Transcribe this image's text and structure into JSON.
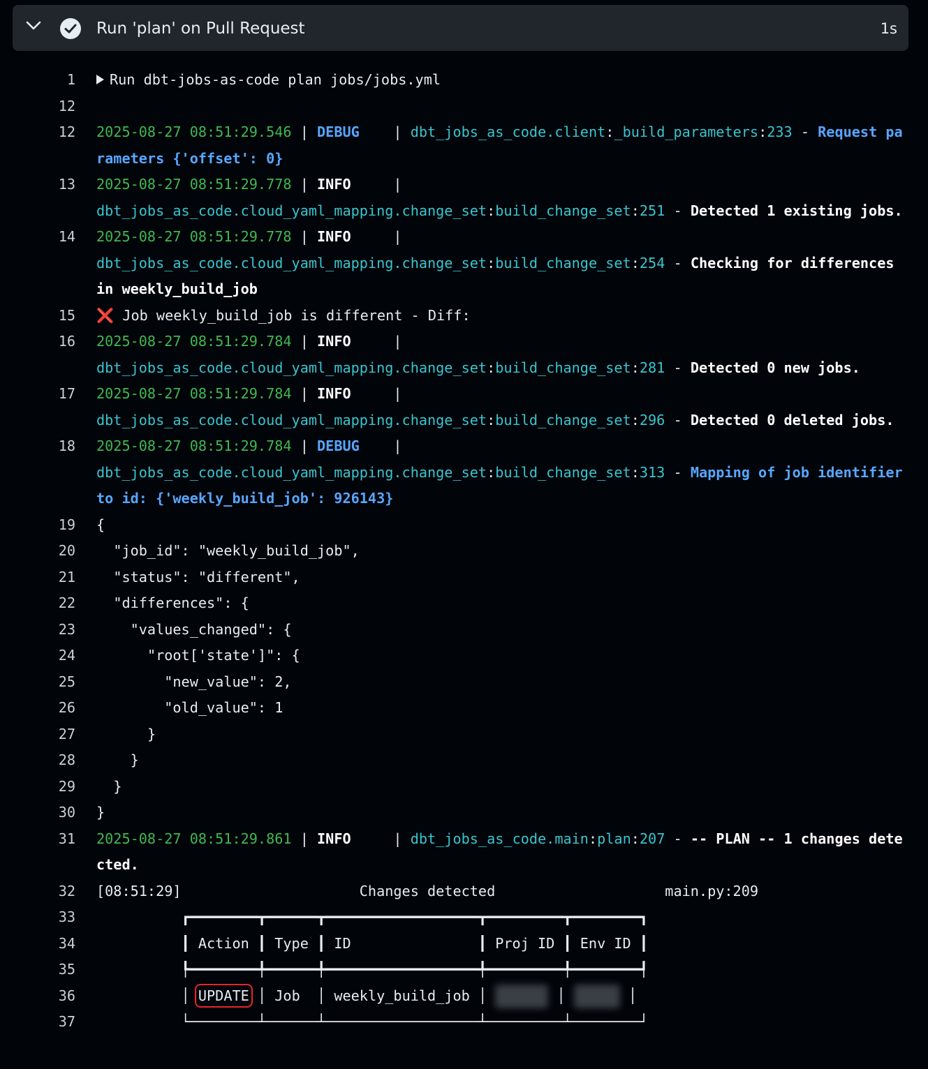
{
  "step": {
    "title": "Run 'plan' on Pull Request",
    "duration": "1s"
  },
  "log": [
    {
      "n": "1",
      "segments": [
        {
          "t": "Run dbt-jobs-as-code plan jobs/jobs.yml",
          "c": "plain"
        }
      ],
      "toggle": true
    },
    {
      "n": "12",
      "segments": []
    },
    {
      "n": "12",
      "segments": [
        {
          "t": "2025-08-27 08:51:29.546",
          "c": "ts"
        },
        {
          "t": " | ",
          "c": "plain"
        },
        {
          "t": "DEBUG",
          "c": "lvl-debug"
        },
        {
          "t": "    | ",
          "c": "plain"
        },
        {
          "t": "dbt_jobs_as_code.client",
          "c": "mod"
        },
        {
          "t": ":",
          "c": "plain"
        },
        {
          "t": "_build_parameters",
          "c": "mod"
        },
        {
          "t": ":",
          "c": "plain"
        },
        {
          "t": "233",
          "c": "mod"
        },
        {
          "t": " - ",
          "c": "plain"
        },
        {
          "t": "Request parameters {'offset': 0}",
          "c": "msg-blue"
        }
      ]
    },
    {
      "n": "13",
      "segments": [
        {
          "t": "2025-08-27 08:51:29.778",
          "c": "ts"
        },
        {
          "t": " | ",
          "c": "plain"
        },
        {
          "t": "INFO",
          "c": "lvl-info"
        },
        {
          "t": "     |\n",
          "c": "plain"
        },
        {
          "t": "dbt_jobs_as_code.cloud_yaml_mapping.change_set",
          "c": "mod"
        },
        {
          "t": ":",
          "c": "plain"
        },
        {
          "t": "build_change_set",
          "c": "mod"
        },
        {
          "t": ":",
          "c": "plain"
        },
        {
          "t": "251",
          "c": "mod"
        },
        {
          "t": " - ",
          "c": "plain"
        },
        {
          "t": "Detected 1 existing jobs.",
          "c": "msg-bold"
        }
      ]
    },
    {
      "n": "14",
      "segments": [
        {
          "t": "2025-08-27 08:51:29.778",
          "c": "ts"
        },
        {
          "t": " | ",
          "c": "plain"
        },
        {
          "t": "INFO",
          "c": "lvl-info"
        },
        {
          "t": "     |\n",
          "c": "plain"
        },
        {
          "t": "dbt_jobs_as_code.cloud_yaml_mapping.change_set",
          "c": "mod"
        },
        {
          "t": ":",
          "c": "plain"
        },
        {
          "t": "build_change_set",
          "c": "mod"
        },
        {
          "t": ":",
          "c": "plain"
        },
        {
          "t": "254",
          "c": "mod"
        },
        {
          "t": " - ",
          "c": "plain"
        },
        {
          "t": "Checking for differences in weekly_build_job",
          "c": "msg-bold"
        }
      ]
    },
    {
      "n": "15",
      "segments": [
        {
          "t": "❌",
          "c": "xmark"
        },
        {
          "t": " Job weekly_build_job is different - Diff:",
          "c": "plain"
        }
      ]
    },
    {
      "n": "16",
      "segments": [
        {
          "t": "2025-08-27 08:51:29.784",
          "c": "ts"
        },
        {
          "t": " | ",
          "c": "plain"
        },
        {
          "t": "INFO",
          "c": "lvl-info"
        },
        {
          "t": "     |\n",
          "c": "plain"
        },
        {
          "t": "dbt_jobs_as_code.cloud_yaml_mapping.change_set",
          "c": "mod"
        },
        {
          "t": ":",
          "c": "plain"
        },
        {
          "t": "build_change_set",
          "c": "mod"
        },
        {
          "t": ":",
          "c": "plain"
        },
        {
          "t": "281",
          "c": "mod"
        },
        {
          "t": " - ",
          "c": "plain"
        },
        {
          "t": "Detected 0 new jobs.",
          "c": "msg-bold"
        }
      ]
    },
    {
      "n": "17",
      "segments": [
        {
          "t": "2025-08-27 08:51:29.784",
          "c": "ts"
        },
        {
          "t": " | ",
          "c": "plain"
        },
        {
          "t": "INFO",
          "c": "lvl-info"
        },
        {
          "t": "     |\n",
          "c": "plain"
        },
        {
          "t": "dbt_jobs_as_code.cloud_yaml_mapping.change_set",
          "c": "mod"
        },
        {
          "t": ":",
          "c": "plain"
        },
        {
          "t": "build_change_set",
          "c": "mod"
        },
        {
          "t": ":",
          "c": "plain"
        },
        {
          "t": "296",
          "c": "mod"
        },
        {
          "t": " - ",
          "c": "plain"
        },
        {
          "t": "Detected 0 deleted jobs.",
          "c": "msg-bold"
        }
      ]
    },
    {
      "n": "18",
      "segments": [
        {
          "t": "2025-08-27 08:51:29.784",
          "c": "ts"
        },
        {
          "t": " | ",
          "c": "plain"
        },
        {
          "t": "DEBUG",
          "c": "lvl-debug"
        },
        {
          "t": "    |\n",
          "c": "plain"
        },
        {
          "t": "dbt_jobs_as_code.cloud_yaml_mapping.change_set",
          "c": "mod"
        },
        {
          "t": ":",
          "c": "plain"
        },
        {
          "t": "build_change_set",
          "c": "mod"
        },
        {
          "t": ":",
          "c": "plain"
        },
        {
          "t": "313",
          "c": "mod"
        },
        {
          "t": " - ",
          "c": "plain"
        },
        {
          "t": "Mapping of job identifier to id: {'weekly_build_job': 926143}",
          "c": "msg-blue"
        }
      ]
    },
    {
      "n": "19",
      "segments": [
        {
          "t": "{",
          "c": "plain"
        }
      ]
    },
    {
      "n": "20",
      "segments": [
        {
          "t": "  \"job_id\": \"weekly_build_job\",",
          "c": "plain"
        }
      ]
    },
    {
      "n": "21",
      "segments": [
        {
          "t": "  \"status\": \"different\",",
          "c": "plain"
        }
      ]
    },
    {
      "n": "22",
      "segments": [
        {
          "t": "  \"differences\": {",
          "c": "plain"
        }
      ]
    },
    {
      "n": "23",
      "segments": [
        {
          "t": "    \"values_changed\": {",
          "c": "plain"
        }
      ]
    },
    {
      "n": "24",
      "segments": [
        {
          "t": "      \"root['state']\": {",
          "c": "plain"
        }
      ]
    },
    {
      "n": "25",
      "segments": [
        {
          "t": "        \"new_value\": 2,",
          "c": "plain"
        }
      ]
    },
    {
      "n": "26",
      "segments": [
        {
          "t": "        \"old_value\": 1",
          "c": "plain"
        }
      ]
    },
    {
      "n": "27",
      "segments": [
        {
          "t": "      }",
          "c": "plain"
        }
      ]
    },
    {
      "n": "28",
      "segments": [
        {
          "t": "    }",
          "c": "plain"
        }
      ]
    },
    {
      "n": "29",
      "segments": [
        {
          "t": "  }",
          "c": "plain"
        }
      ]
    },
    {
      "n": "30",
      "segments": [
        {
          "t": "}",
          "c": "plain"
        }
      ]
    },
    {
      "n": "31",
      "segments": [
        {
          "t": "2025-08-27 08:51:29.861",
          "c": "ts"
        },
        {
          "t": " | ",
          "c": "plain"
        },
        {
          "t": "INFO",
          "c": "lvl-info"
        },
        {
          "t": "     | ",
          "c": "plain"
        },
        {
          "t": "dbt_jobs_as_code.main",
          "c": "mod"
        },
        {
          "t": ":",
          "c": "plain"
        },
        {
          "t": "plan",
          "c": "mod"
        },
        {
          "t": ":",
          "c": "plain"
        },
        {
          "t": "207",
          "c": "mod"
        },
        {
          "t": " - ",
          "c": "plain"
        },
        {
          "t": "-- PLAN -- 1 changes detected.",
          "c": "msg-bold"
        }
      ]
    },
    {
      "n": "32",
      "segments": [
        {
          "t": "[08:51:29]                     Changes detected                    main.py:209",
          "c": "plain"
        }
      ]
    },
    {
      "n": "33",
      "segments": [
        {
          "t": "          ┏━━━━━━━━┳━━━━━━┳━━━━━━━━━━━━━━━━━━┳━━━━━━━━━┳━━━━━━━━┓",
          "c": "plain"
        }
      ]
    },
    {
      "n": "34",
      "segments": [
        {
          "t": "          ┃ Action ┃ Type ┃ ID               ┃ Proj ID ┃ Env ID ┃",
          "c": "plain"
        }
      ]
    },
    {
      "n": "35",
      "segments": [
        {
          "t": "          ┡━━━━━━━━╇━━━━━━╇━━━━━━━━━━━━━━━━━━╇━━━━━━━━━╇━━━━━━━━┩",
          "c": "plain"
        }
      ]
    },
    {
      "n": "36",
      "segments": [
        {
          "t": "          │ ",
          "c": "plain"
        },
        {
          "t": "UPDATE",
          "c": "update"
        },
        {
          "t": " │ Job  │ weekly_build_job │ ",
          "c": "plain"
        },
        {
          "t": "",
          "c": "blur"
        },
        {
          "t": " │ ",
          "c": "plain"
        },
        {
          "t": "",
          "c": "blur2"
        },
        {
          "t": " │",
          "c": "plain"
        }
      ]
    },
    {
      "n": "37",
      "segments": [
        {
          "t": "          └────────┴──────┴──────────────────┴─────────┴────────┘",
          "c": "plain"
        }
      ]
    }
  ]
}
